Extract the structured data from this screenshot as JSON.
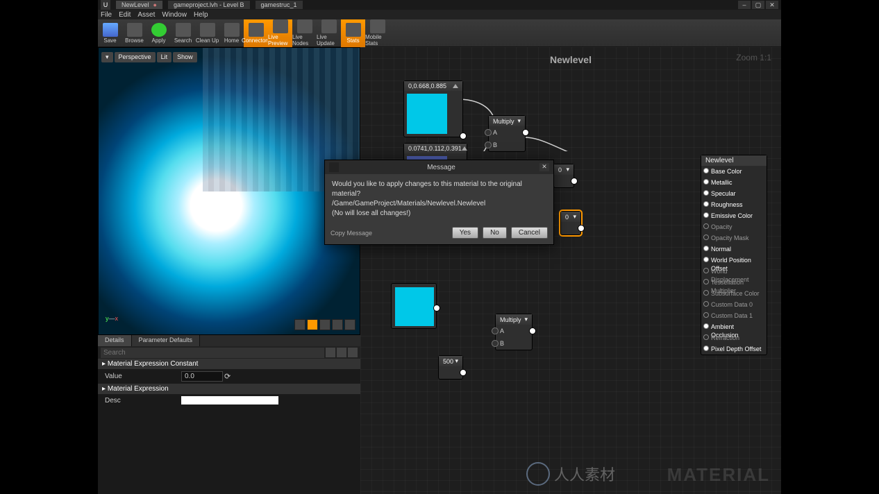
{
  "titlebar": {
    "tabs": [
      {
        "label": "NewLevel",
        "dirty": true
      },
      {
        "label": "gameproject.lvh - Level B"
      },
      {
        "label": "gamestruc_1"
      }
    ],
    "window_controls": [
      "–",
      "▢",
      "✕"
    ]
  },
  "menubar": [
    "File",
    "Edit",
    "Asset",
    "Window",
    "Help"
  ],
  "toolbar": [
    {
      "label": "Save"
    },
    {
      "label": "Browse"
    },
    {
      "label": "Apply"
    },
    {
      "label": "Search"
    },
    {
      "label": "Clean Up"
    },
    {
      "label": "Home"
    },
    {
      "label": "Connectors",
      "active": true
    },
    {
      "label": "Live Preview",
      "active": true
    },
    {
      "label": "Live Nodes"
    },
    {
      "label": "Live Update"
    },
    {
      "label": "Stats",
      "active": true
    },
    {
      "label": "Mobile Stats"
    }
  ],
  "viewport": {
    "buttons": [
      "Perspective",
      "Lit",
      "Show"
    ],
    "axis_y": "y",
    "axis_x": "x"
  },
  "details": {
    "tabs": [
      "Details",
      "Parameter Defaults"
    ],
    "search_placeholder": "Search",
    "section1": "Material Expression Constant",
    "value_label": "Value",
    "value": "0.0",
    "section2": "Material Expression",
    "desc_label": "Desc",
    "desc": ""
  },
  "graph": {
    "title": "Newlevel",
    "zoom": "Zoom 1:1",
    "watermark": "MATERIAL",
    "watermark2": "人人素材",
    "nodes": {
      "const1": {
        "header": "0,0.668,0.885",
        "color": "#00c8e8"
      },
      "const2": {
        "header": "0.0741,0.112,0.391",
        "color": "#4a5aa8"
      },
      "const3": {
        "color": "#00c8e8"
      },
      "mult1": {
        "title": "Multiply",
        "a": "A",
        "b": "B"
      },
      "mult2": {
        "title": "Multiply",
        "a": "A",
        "b": "B"
      },
      "scalar0": {
        "value": "0"
      },
      "scalar0b": {
        "value": "0"
      },
      "scalar500": {
        "value": "500"
      }
    },
    "material_output": {
      "title": "Newlevel",
      "pins": [
        {
          "label": "Base Color",
          "on": true
        },
        {
          "label": "Metallic",
          "on": true
        },
        {
          "label": "Specular",
          "on": true
        },
        {
          "label": "Roughness",
          "on": true
        },
        {
          "label": "Emissive Color",
          "on": true
        },
        {
          "label": "Opacity",
          "on": false
        },
        {
          "label": "Opacity Mask",
          "on": false
        },
        {
          "label": "Normal",
          "on": true
        },
        {
          "label": "World Position Offset",
          "on": true
        },
        {
          "label": "World Displacement",
          "on": false
        },
        {
          "label": "Tessellation Multiplier",
          "on": false
        },
        {
          "label": "Subsurface Color",
          "on": false
        },
        {
          "label": "Custom Data 0",
          "on": false
        },
        {
          "label": "Custom Data 1",
          "on": false
        },
        {
          "label": "Ambient Occlusion",
          "on": true
        },
        {
          "label": "Refraction",
          "on": false
        },
        {
          "label": "Pixel Depth Offset",
          "on": true
        }
      ]
    }
  },
  "dialog": {
    "title": "Message",
    "line1": "Would you like to apply changes to this material to the original material?",
    "line2": "/Game/GameProject/Materials/Newlevel.Newlevel",
    "line3": "(No will lose all changes!)",
    "copy": "Copy Message",
    "yes": "Yes",
    "no": "No",
    "cancel": "Cancel"
  }
}
